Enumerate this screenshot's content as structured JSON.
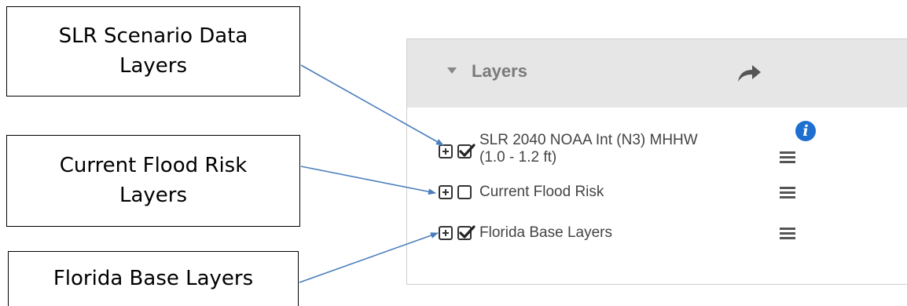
{
  "callouts": [
    {
      "text": "SLR Scenario Data Layers"
    },
    {
      "text": "Current Flood Risk Layers"
    },
    {
      "text": "Florida Base Layers"
    }
  ],
  "panel": {
    "title": "Layers",
    "caret_icon": "caret-down-icon",
    "share_icon": "share-arrow-icon"
  },
  "layers": [
    {
      "label_line1": "SLR 2040 NOAA Int (N3) MHHW",
      "label_line2": "(1.0 - 1.2 ft)",
      "checked": true,
      "has_info": true
    },
    {
      "label_line1": "Current Flood Risk",
      "checked": false
    },
    {
      "label_line1": "Florida Base Layers",
      "checked": true
    }
  ],
  "info_glyph": "i",
  "colors": {
    "header_bg": "#e6e6e6",
    "arrow": "#4a7ebb",
    "info": "#1e6fd0"
  }
}
